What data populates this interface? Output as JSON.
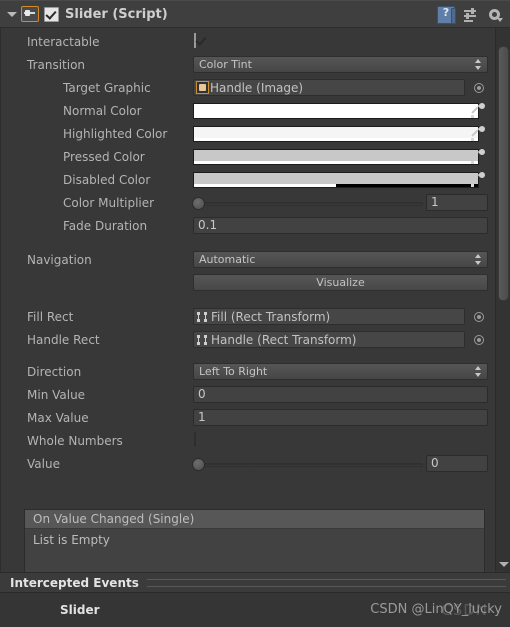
{
  "component": {
    "title": "Slider (Script)",
    "enabled_checkbox": true,
    "icons": {
      "foldout": "triangle-down-icon",
      "script": "script-icon",
      "help": "help-book-icon",
      "preset": "preset-icon",
      "settings": "gear-icon"
    }
  },
  "rows": {
    "interactable": {
      "label": "Interactable",
      "checked": true
    },
    "transition": {
      "label": "Transition",
      "value": "Color Tint"
    },
    "target_graphic": {
      "label": "Target Graphic",
      "value": "Handle (Image)"
    },
    "normal_color": {
      "label": "Normal Color",
      "color": "#ffffff",
      "alpha_pct": 100
    },
    "highlighted_color": {
      "label": "Highlighted Color",
      "color": "#f5f5f5",
      "alpha_pct": 100
    },
    "pressed_color": {
      "label": "Pressed Color",
      "color": "#c8c8c8",
      "alpha_pct": 100
    },
    "disabled_color": {
      "label": "Disabled Color",
      "color": "#c8c8c8",
      "alpha_pct": 50
    },
    "color_multiplier": {
      "label": "Color Multiplier",
      "value": "1",
      "knob_pct": 0
    },
    "fade_duration": {
      "label": "Fade Duration",
      "value": "0.1"
    },
    "navigation": {
      "label": "Navigation",
      "value": "Automatic"
    },
    "visualize": {
      "label": "Visualize"
    },
    "fill_rect": {
      "label": "Fill Rect",
      "value": "Fill (Rect Transform)"
    },
    "handle_rect": {
      "label": "Handle Rect",
      "value": "Handle (Rect Transform)"
    },
    "direction": {
      "label": "Direction",
      "value": "Left To Right"
    },
    "min_value": {
      "label": "Min Value",
      "value": "0"
    },
    "max_value": {
      "label": "Max Value",
      "value": "1"
    },
    "whole_numbers": {
      "label": "Whole Numbers",
      "checked": false
    },
    "value": {
      "label": "Value",
      "value": "0",
      "knob_pct": 0
    }
  },
  "event_list": {
    "header": "On Value Changed (Single)",
    "empty_text": "List is Empty"
  },
  "intercepted": {
    "title": "Intercepted Events",
    "entry": "Slider"
  },
  "watermark": {
    "text": "CSDN @LinQY_lucky",
    "logo": "CSDN"
  }
}
